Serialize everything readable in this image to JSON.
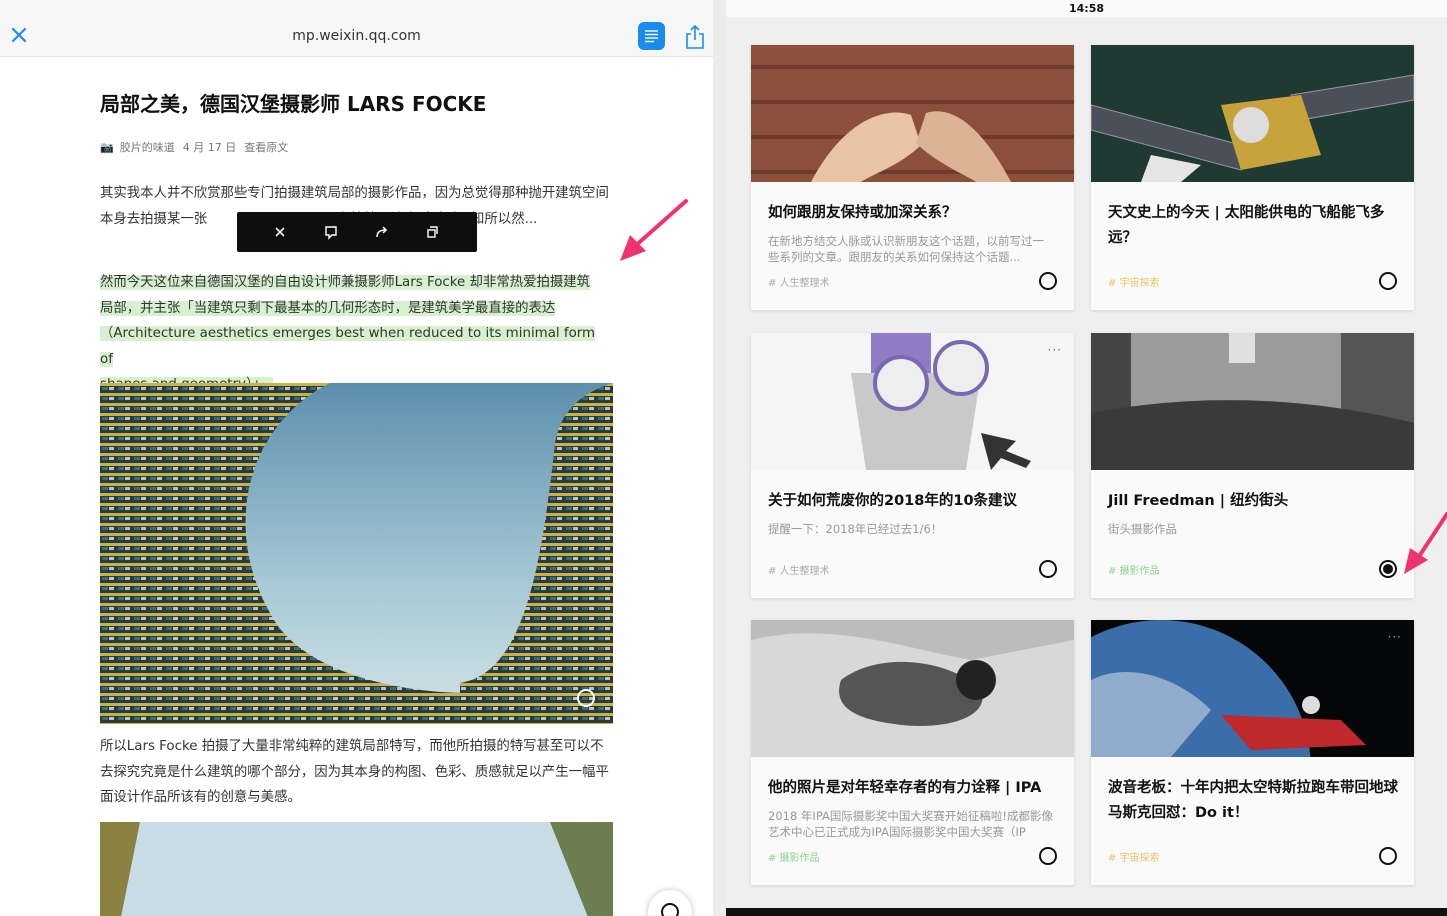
{
  "reader": {
    "url": "mp.weixin.qq.com",
    "title": "局部之美，德国汉堡摄影师 LARS FOCKE",
    "meta": {
      "author": "胶片的味道",
      "date": "4 月 17 日",
      "link": "查看原文"
    },
    "para1": {
      "a": "其实我本人并不欣赏那些专门拍摄建筑局部的摄影作品，因为总觉得那种抛开建筑空间本身去拍摄某一张",
      "b": "在炫技，让人看过后不知所以然..."
    },
    "para2_lines": [
      "然而今天这位来自德国汉堡的自由设计师兼摄影师Lars Focke 却非常热爱拍摄建筑",
      "局部，并主张「当建筑只剩下最基本的几何形态时，是建筑美学最直接的表达",
      "（Architecture aesthetics emerges best when reduced to its minimal form of",
      "shapes and geometry）」。"
    ],
    "para3": "所以Lars Focke 拍摄了大量非常纯粹的建筑局部特写，而他所拍摄的特写甚至可以不去探究究竟是什么建筑的哪个部分，因为其本身的构图、色彩、质感就足以产生一幅平面设计作品所该有的创意与美感。"
  },
  "status": {
    "time": "14:58"
  },
  "cards": [
    {
      "title": "如何跟朋友保持或加深关系？",
      "desc": "在新地方结交人脉或认识新朋友这个话题，以前写过一些系列的文章。跟朋友的关系如何保持这个话题...",
      "tag": "# 人生整理术",
      "tag_color": "#aaaaaa",
      "done": false
    },
    {
      "title": "天文史上的今天 | 太阳能供电的飞船能飞多远？",
      "desc": "",
      "tag": "# 宇宙探索",
      "tag_color": "#e9c36a",
      "done": false
    },
    {
      "title": "关于如何荒废你的2018年的10条建议",
      "desc": "提醒一下：2018年已经过去1/6！",
      "tag": "# 人生整理术",
      "tag_color": "#aaaaaa",
      "done": false
    },
    {
      "title": "Jill Freedman | 纽约街头",
      "desc": "街头摄影作品",
      "tag": "# 摄影作品",
      "tag_color": "#8fd08f",
      "done": true
    },
    {
      "title": "他的照片是对年轻幸存者的有力诠释 | IPA",
      "desc": "2018 年IPA国际摄影奖中国大奖赛开始征稿啦!成都影像艺术中心已正式成为IPA国际摄影奖中国大奖赛（IP",
      "tag": "# 摄影作品",
      "tag_color": "#8fd08f",
      "done": false
    },
    {
      "title": "波音老板：十年内把太空特斯拉跑车带回地球 马斯克回怼：Do it！",
      "desc": "",
      "tag": "# 宇宙探索",
      "tag_color": "#e9c36a",
      "done": false
    }
  ],
  "icons": {
    "close": "close-icon",
    "reader": "reader-mode-icon",
    "share": "share-icon",
    "more": "more-icon"
  },
  "colors": {
    "accent": "#1a8cf0",
    "highlight": "#d7f0d0",
    "arrow": "#f0326e"
  }
}
